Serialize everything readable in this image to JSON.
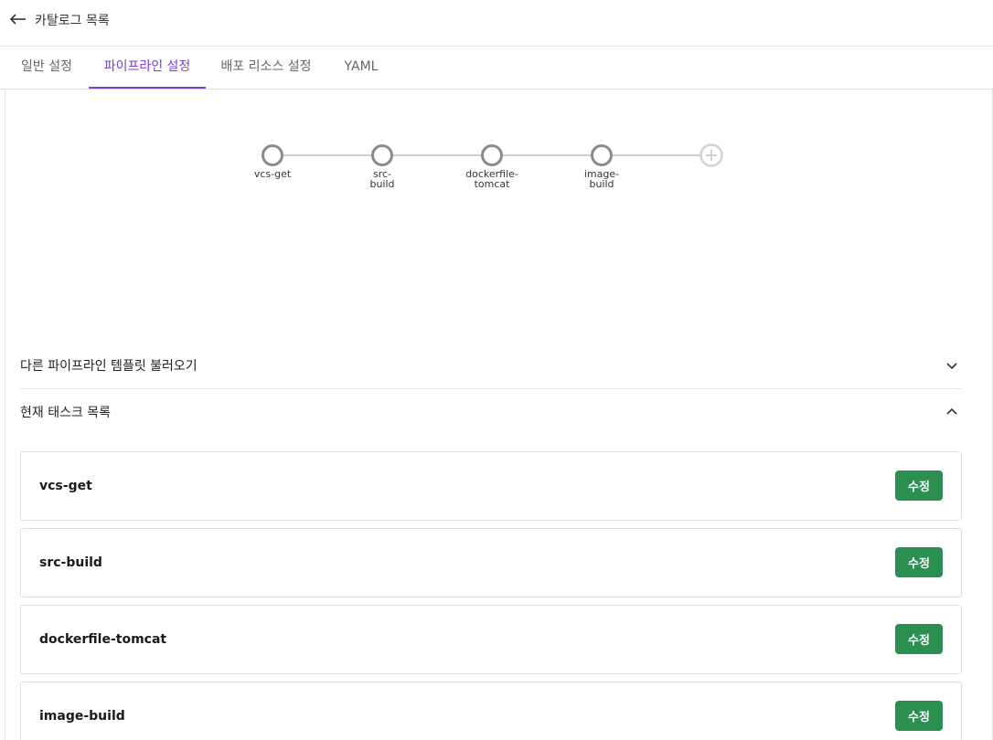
{
  "header": {
    "back_label": "카탈로그 목록"
  },
  "tabs": [
    {
      "label": "일반 설정",
      "active": false
    },
    {
      "label": "파이프라인 설정",
      "active": true
    },
    {
      "label": "배포 리소스 설정",
      "active": false
    },
    {
      "label": "YAML",
      "active": false
    }
  ],
  "pipeline": {
    "nodes": [
      {
        "line1": "vcs-get",
        "line2": ""
      },
      {
        "line1": "src-",
        "line2": "build"
      },
      {
        "line1": "dockerfile-",
        "line2": "tomcat"
      },
      {
        "line1": "image-",
        "line2": "build"
      }
    ]
  },
  "sections": {
    "load_template": "다른 파이프라인 템플릿 불러오기",
    "current_tasks": "현재 태스크 목록"
  },
  "tasks": [
    {
      "name": "vcs-get",
      "edit_label": "수정"
    },
    {
      "name": "src-build",
      "edit_label": "수정"
    },
    {
      "name": "dockerfile-tomcat",
      "edit_label": "수정"
    },
    {
      "name": "image-build",
      "edit_label": "수정"
    }
  ],
  "colors": {
    "accent": "#7b3fd0",
    "edit_button": "#2b8f52",
    "node": "#8a8a8a"
  }
}
